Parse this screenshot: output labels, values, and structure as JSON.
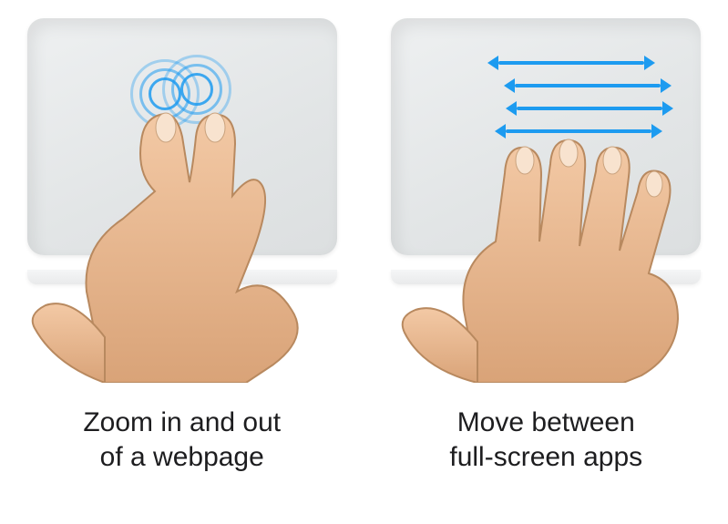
{
  "gestures": [
    {
      "id": "pinch-zoom",
      "caption": "Zoom in and out\nof a webpage",
      "indicator": "pinch-rings-icon",
      "touch_points": 2,
      "motion": "pinch",
      "accent_color": "#1d9bf0"
    },
    {
      "id": "four-finger-swipe",
      "caption": "Move between\nfull-screen apps",
      "indicator": "horizontal-arrows-icon",
      "touch_points": 4,
      "motion": "horizontal-swipe",
      "accent_color": "#1d9bf0"
    }
  ]
}
